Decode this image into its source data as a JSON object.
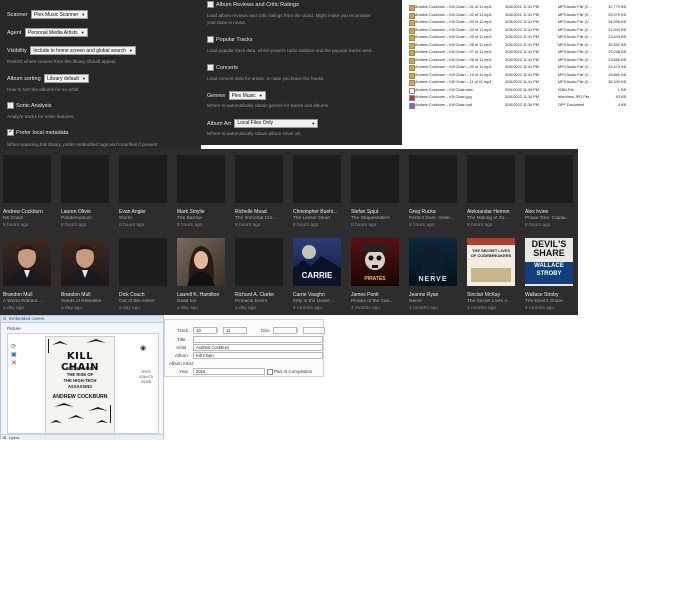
{
  "settings_left": {
    "scanner_label": "Scanner",
    "scanner_value": "Plex Music Scanner",
    "agent_label": "Agent",
    "agent_value": "Personal Media Artists",
    "visibility_label": "Visibility",
    "visibility_value": "Include in home screen and global search",
    "visibility_help": "Restrict where content from this library should appear.",
    "album_sorting_label": "Album sorting",
    "album_sorting_value": "Library default",
    "album_sorting_help": "How to sort the albums for an artist.",
    "sonic_label": "Sonic Analysis",
    "sonic_help": "Analyze tracks for sonic features.",
    "prefer_meta_label": "Prefer local metadata",
    "prefer_meta_help": "When scanning this library, prefer embedded tags and local files if present."
  },
  "settings_right": {
    "reviews_label": "Album Reviews and Critic Ratings",
    "reviews_help_1": "Load album reviews and critic ratings from the cloud. Might make you reconsider",
    "reviews_help_2": "your taste in music.",
    "popular_label": "Popular Tracks",
    "popular_help": "Load popular track data, which powers radio stations and the popular tracks area.",
    "concerts_label": "Concerts",
    "concerts_help": "Load concert data for artists, in case you leave the house.",
    "genres_label": "Genres",
    "genres_value": "Plex Music",
    "genres_help": "Where to automatically obtain genres for tracks and albums.",
    "albumart_label": "Album Art",
    "albumart_value": "Local Files Only",
    "albumart_help": "Where to automatically obtain album cover art."
  },
  "file_list": [
    {
      "name": "Andrew Cockburn – Kill Chain – 01 of 11.mp3",
      "date": "3/26/2022 11:41 PM",
      "type": "MP3 Audio File (V…",
      "size": "32,779 KB",
      "icon": "audio-icon"
    },
    {
      "name": "Andrew Cockburn – Kill Chain – 02 of 11.mp3",
      "date": "3/26/2022 11:41 PM",
      "type": "MP3 Audio File (V…",
      "size": "25,975 KB",
      "icon": "audio-icon"
    },
    {
      "name": "Andrew Cockburn – Kill Chain – 03 of 11.mp3",
      "date": "3/26/2022 11:41 PM",
      "type": "MP3 Audio File (V…",
      "size": "24,596 KB",
      "icon": "audio-icon"
    },
    {
      "name": "Andrew Cockburn – Kill Chain – 04 of 11.mp3",
      "date": "3/26/2022 11:41 PM",
      "type": "MP3 Audio File (V…",
      "size": "21,543 KB",
      "icon": "audio-icon"
    },
    {
      "name": "Andrew Cockburn – Kill Chain – 05 of 11.mp3",
      "date": "3/26/2022 11:41 PM",
      "type": "MP3 Audio File (V…",
      "size": "23,443 KB",
      "icon": "audio-icon"
    },
    {
      "name": "Andrew Cockburn – Kill Chain – 06 of 11.mp3",
      "date": "3/26/2022 11:41 PM",
      "type": "MP3 Audio File (V…",
      "size": "35,552 KB",
      "icon": "audio-icon"
    },
    {
      "name": "Andrew Cockburn – Kill Chain – 07 of 11.mp3",
      "date": "3/26/2022 11:41 PM",
      "type": "MP3 Audio File (V…",
      "size": "19,098 KB",
      "icon": "audio-icon"
    },
    {
      "name": "Andrew Cockburn – Kill Chain – 08 of 11.mp3",
      "date": "3/26/2022 11:41 PM",
      "type": "MP3 Audio File (V…",
      "size": "23,656 KB",
      "icon": "audio-icon"
    },
    {
      "name": "Andrew Cockburn – Kill Chain – 09 of 11.mp3",
      "date": "3/26/2022 11:41 PM",
      "type": "MP3 Audio File (V…",
      "size": "24,474 KB",
      "icon": "audio-icon"
    },
    {
      "name": "Andrew Cockburn – Kill Chain – 10 of 11.mp3",
      "date": "3/26/2022 11:41 PM",
      "type": "MP3 Audio File (V…",
      "size": "19,660 KB",
      "icon": "audio-icon"
    },
    {
      "name": "Andrew Cockburn – Kill Chain – 11 of 11.mp3",
      "date": "3/26/2022 11:41 PM",
      "type": "MP3 Audio File (V…",
      "size": "36,340 KB",
      "icon": "audio-icon"
    },
    {
      "name": "Andrew Cockburn – Kill Chain.isbn",
      "date": "3/26/2022 11:39 PM",
      "type": "ISBN File",
      "size": "1 KB",
      "icon": "file-icon"
    },
    {
      "name": "Andrew Cockburn – Kill Chain.jpg",
      "date": "3/26/2022 11:34 PM",
      "type": "IrfanView JPG File",
      "size": "93 KB",
      "icon": "image-icon"
    },
    {
      "name": "Andrew Cockburn – Kill Chain.opf",
      "date": "3/26/2022 11:34 PM",
      "type": "OPF Document",
      "size": "4 KB",
      "icon": "doc-icon"
    }
  ],
  "library_row1": [
    {
      "name": "Andrew Cockburn",
      "sub": "Kill Chain",
      "time": "8 hours ago"
    },
    {
      "name": "Lauren Oliver",
      "sub": "Pandemonium",
      "time": "8 hours ago"
    },
    {
      "name": "Evan Angler",
      "sub": "Storm",
      "time": "8 hours ago"
    },
    {
      "name": "Mark Smylie",
      "sub": "The Barrow",
      "time": "8 hours ago"
    },
    {
      "name": "Richelle Mead",
      "sub": "The Immortal Cro…",
      "time": "8 hours ago"
    },
    {
      "name": "Christopher Buehl…",
      "sub": "The Lesser Dead",
      "time": "8 hours ago"
    },
    {
      "name": "Stefan Spjut",
      "sub": "The Shapeshifters",
      "time": "8 hours ago"
    },
    {
      "name": "Greg Rucka",
      "sub": "Perfect Dark: Initial…",
      "time": "8 hours ago"
    },
    {
      "name": "Aleksandar Hemon",
      "sub": "The Making of Zo…",
      "time": "8 hours ago"
    },
    {
      "name": "Alex Irvine",
      "sub": "Phase One: Captai…",
      "time": "8 hours ago"
    }
  ],
  "library_row2": [
    {
      "name": "Brandon Mull",
      "sub": "A World Without …",
      "time": "a day ago",
      "art": "portrait"
    },
    {
      "name": "Brandon Mull",
      "sub": "Seeds of Rebellion",
      "time": "a day ago",
      "art": "portrait"
    },
    {
      "name": "Dick Couch",
      "sub": "Out of the Ashes",
      "time": "a day ago",
      "art": "blank"
    },
    {
      "name": "Laurell K. Hamilton",
      "sub": "Dead Ice",
      "time": "a day ago",
      "art": "woman"
    },
    {
      "name": "Richard A. Clarke",
      "sub": "Pinnacle Event",
      "time": "a day ago",
      "art": "blank"
    },
    {
      "name": "Carrie Vaughn",
      "sub": "Kitty in the Under…",
      "time": "4 months ago",
      "art": "cover-carrie"
    },
    {
      "name": "James Ponti",
      "sub": "Pirates of the Cari…",
      "time": "4 months ago",
      "art": "cover-pirates"
    },
    {
      "name": "Jeanne Ryan",
      "sub": "Nerve",
      "time": "4 months ago",
      "art": "cover-nerve"
    },
    {
      "name": "Sinclair McKay",
      "sub": "The Secret Lives o…",
      "time": "4 months ago",
      "art": "cover-secret"
    },
    {
      "name": "Wallace Stroby",
      "sub": "The Devil's Share",
      "time": "4 months ago",
      "art": "cover-devils"
    }
  ],
  "cover_texts": {
    "carrie": "CARRIE",
    "pirates_top": "PIRATES",
    "nerve": "NERVE",
    "secret": "THE SECRET LIVES OF CODEBREAKERS",
    "devils_1": "DEVIL'S",
    "devils_2": "SHARE",
    "devils_3": "WALLACE",
    "devils_4": "STROBY"
  },
  "tag_editor": {
    "header": "Embedded covers",
    "picture_label": "Picture",
    "cover_title": "KILL CHAIN",
    "cover_subtitle_1": "DRONES AND",
    "cover_subtitle_2": "THE RISE OF",
    "cover_subtitle_3": "THE HIGH-TECH",
    "cover_subtitle_4": "ASSASSINS",
    "cover_author": "ANDREW COCKBURN",
    "img_format": "JPEG",
    "img_size": "315x475",
    "img_bits": "93 KB",
    "footer": "Lyrics"
  },
  "fields": {
    "track_label": "Track",
    "track_value": "10",
    "track_total": "11",
    "disc_label": "Disc",
    "title_label": "Title",
    "title_value": "",
    "artist_label": "Artist",
    "artist_value": "Andrew Cockburn",
    "album_label": "Album",
    "album_value": "Kill Chain",
    "album_artist_label": "Album Artist",
    "year_label": "Year",
    "year_value": "2015",
    "compilation_label": "Part of Compilation"
  },
  "colors": {
    "panel_dark": "#282828",
    "grid_dark": "#2d2d2d",
    "accent_orange": "#e5a00d"
  }
}
